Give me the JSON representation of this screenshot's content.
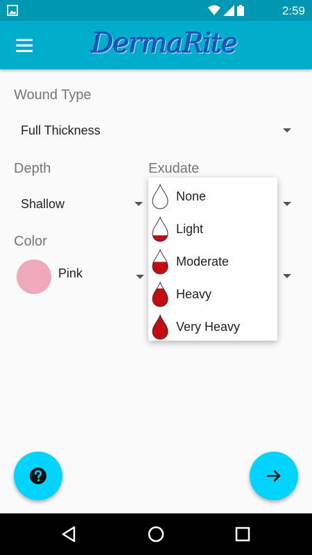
{
  "status_bar": {
    "time": "2:59"
  },
  "app_bar": {
    "title": "DermaRite"
  },
  "form": {
    "wound_type": {
      "label": "Wound Type",
      "value": "Full Thickness"
    },
    "depth": {
      "label": "Depth",
      "value": "Shallow"
    },
    "exudate": {
      "label": "Exudate"
    },
    "color": {
      "label": "Color",
      "value": "Pink",
      "swatch": "#f0a9bb"
    }
  },
  "exudate_dropdown": {
    "options": [
      {
        "label": "None",
        "fill_level": 0
      },
      {
        "label": "Light",
        "fill_level": 0.25
      },
      {
        "label": "Moderate",
        "fill_level": 0.5
      },
      {
        "label": "Heavy",
        "fill_level": 0.75
      },
      {
        "label": "Very Heavy",
        "fill_level": 1
      }
    ]
  },
  "icons": {
    "menu": "hamburger-icon",
    "help": "help-icon",
    "next": "arrow-right-icon",
    "back": "back-triangle-icon",
    "home": "home-circle-icon",
    "recents": "recents-square-icon"
  },
  "colors": {
    "accent": "#00d4ff",
    "app_bar": "#00aecb",
    "status_bar": "#0097b3",
    "drop": "#c40d12"
  }
}
